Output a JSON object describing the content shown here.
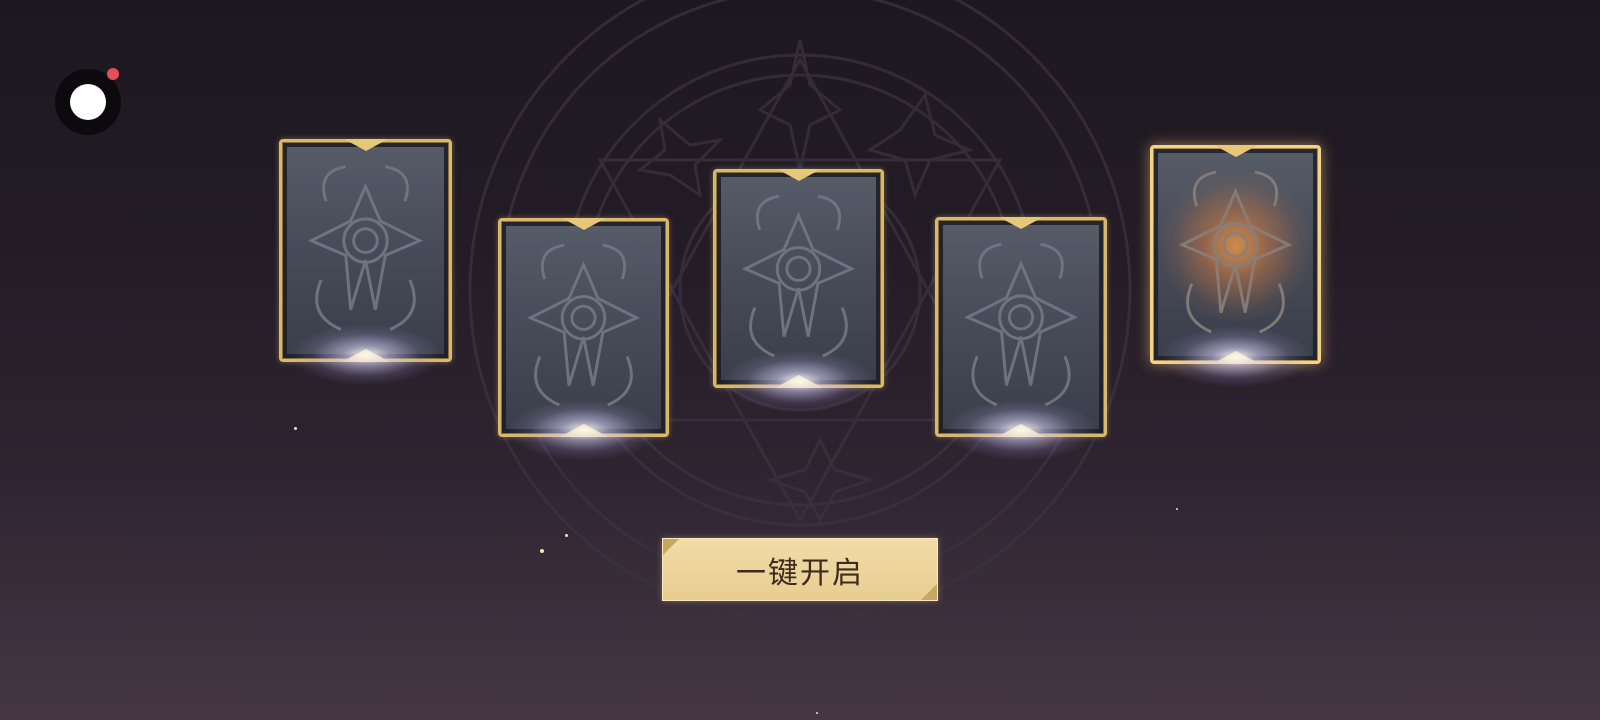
{
  "recorder": {
    "icon": "record-icon",
    "status_color": "#e84c5a"
  },
  "cards": [
    {
      "id": "card-1",
      "state": "face-down",
      "glow": "white",
      "icon": "emblem-icon"
    },
    {
      "id": "card-2",
      "state": "face-down",
      "glow": "white",
      "icon": "emblem-icon"
    },
    {
      "id": "card-3",
      "state": "face-down",
      "glow": "white",
      "icon": "emblem-icon"
    },
    {
      "id": "card-4",
      "state": "face-down",
      "glow": "white",
      "icon": "emblem-icon"
    },
    {
      "id": "card-5",
      "state": "face-down",
      "glow": "orange",
      "icon": "emblem-icon"
    }
  ],
  "open_all_button": {
    "label": "一键开启"
  },
  "colors": {
    "card_frame": "#d9b86a",
    "button_fill": "#ecd49c",
    "button_text": "#3d2c1d",
    "background": "#231c26"
  }
}
